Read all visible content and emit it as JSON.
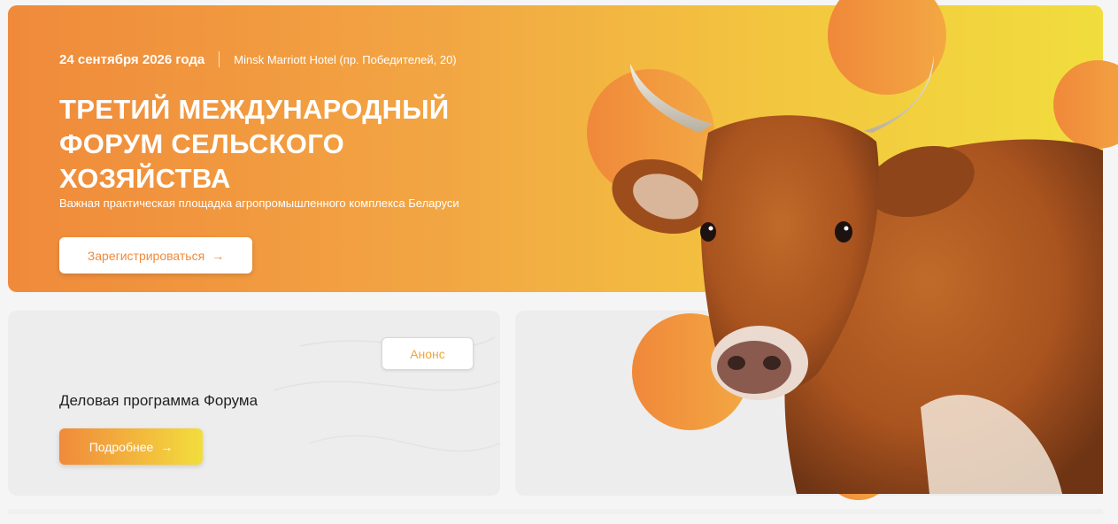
{
  "hero": {
    "date": "24 сентября 2026 года",
    "venue": "Minsk Marriott Hotel (пр. Победителей, 20)",
    "title_lines": [
      "ТРЕТИЙ МЕЖДУНАРОДНЫЙ",
      "ФОРУМ СЕЛЬСКОГО",
      "ХОЗЯЙСТВА"
    ],
    "subtitle": "Важная практическая площадка агропромышленного комплекса Беларуси",
    "register_label": "Зарегистрироваться",
    "arrow": "→"
  },
  "program_card": {
    "badge": "Анонс",
    "title": "Деловая программа Форума",
    "more_label": "Подробнее",
    "arrow": "→"
  },
  "colors": {
    "accent_orange": "#f08a3b",
    "accent_yellow": "#f1dd3d",
    "card_bg": "#ededed"
  }
}
